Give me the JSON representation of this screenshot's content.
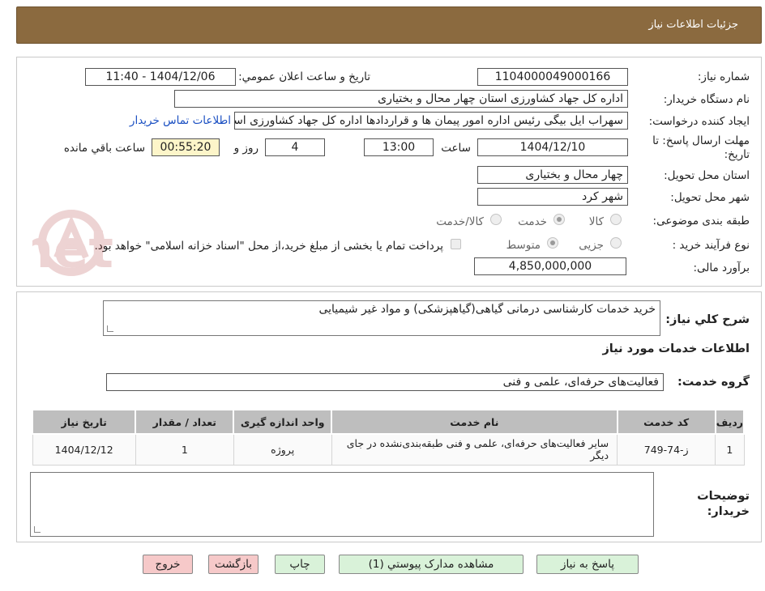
{
  "header": {
    "title": "جزئیات اطلاعات نیاز"
  },
  "form": {
    "need_number_label": "شماره نیاز:",
    "need_number": "1104000049000166",
    "announce_label": "تاریخ و ساعت اعلان عمومي:",
    "announce_value": "1404/12/06 - 11:40",
    "buyer_org_label": "نام دستگاه خريدار:",
    "buyer_org": "اداره کل جهاد کشاورزی استان چهار محال و بختیاری",
    "requester_label": "ايجاد کننده درخواست:",
    "requester": "سهراب ایل بیگی رئیس اداره امور پیمان ها و قراردادها اداره کل جهاد کشاورزی استان چهار محال و بختیاری",
    "contact_link": "اطلاعات تماس خريدار",
    "deadline_label_1": "مهلت ارسال پاسخ: تا",
    "deadline_label_2": "تاريخ:",
    "deadline_date": "1404/12/10",
    "time_label": "ساعت",
    "deadline_time": "13:00",
    "days_value": "4",
    "days_label": "روز و",
    "remaining_time": "00:55:20",
    "remaining_label": "ساعت باقي مانده",
    "province_label": "استان محل تحويل:",
    "province": "چهار محال و بختیاری",
    "city_label": "شهر محل تحويل:",
    "city": "شهر کرد",
    "category_label": "طبقه بندی موضوعی:",
    "category_options": [
      "کالا",
      "خدمت",
      "کالا/خدمت"
    ],
    "category_selected": "خدمت",
    "process_label": "نوع فرآیند خرید :",
    "process_options": [
      "جزیی",
      "متوسط"
    ],
    "process_selected": "متوسط",
    "payment_note": "پرداخت تمام یا بخشی از مبلغ خرید،از محل \"اسناد خزانه اسلامی\" خواهد بود.",
    "budget_label": "برآورد مالی:",
    "budget": "4,850,000,000"
  },
  "details": {
    "summary_label": "شرح کلي نياز:",
    "summary": "خرید خدمات کارشناسی درمانی گیاهی(گیاهپزشکی) و مواد غیر شیمیایی",
    "services_title": "اطلاعات خدمات مورد نياز",
    "service_group_label": "گروه خدمت:",
    "service_group": "فعالیت‌های حرفه‌ای، علمی و فنی",
    "table": {
      "headers": [
        "رديف",
        "کد خدمت",
        "نام خدمت",
        "واحد اندازه گيری",
        "تعداد / مقدار",
        "تاريخ نياز"
      ],
      "rows": [
        [
          "1",
          "ز-74-749",
          "سایر فعالیت‌های حرفه‌ای، علمی و فنی طبقه‌بندی‌نشده در جای دیگر",
          "پروژه",
          "1",
          "1404/12/12"
        ]
      ]
    },
    "buyer_notes_label_1": "توضيحات",
    "buyer_notes_label_2": "خريدار:",
    "buyer_notes": ""
  },
  "buttons": {
    "reply": "پاسخ به نياز",
    "attachments": "مشاهده مدارک پيوستي (1)",
    "print": "چاپ",
    "back": "بازگشت",
    "exit": "خروج"
  },
  "watermark": {
    "text": "AriaTender.net"
  },
  "colors": {
    "header_bg": "#8b6a3f",
    "button_green": "#d9f2d9",
    "button_red": "#f6c9c9",
    "link": "#1a4fc2"
  }
}
